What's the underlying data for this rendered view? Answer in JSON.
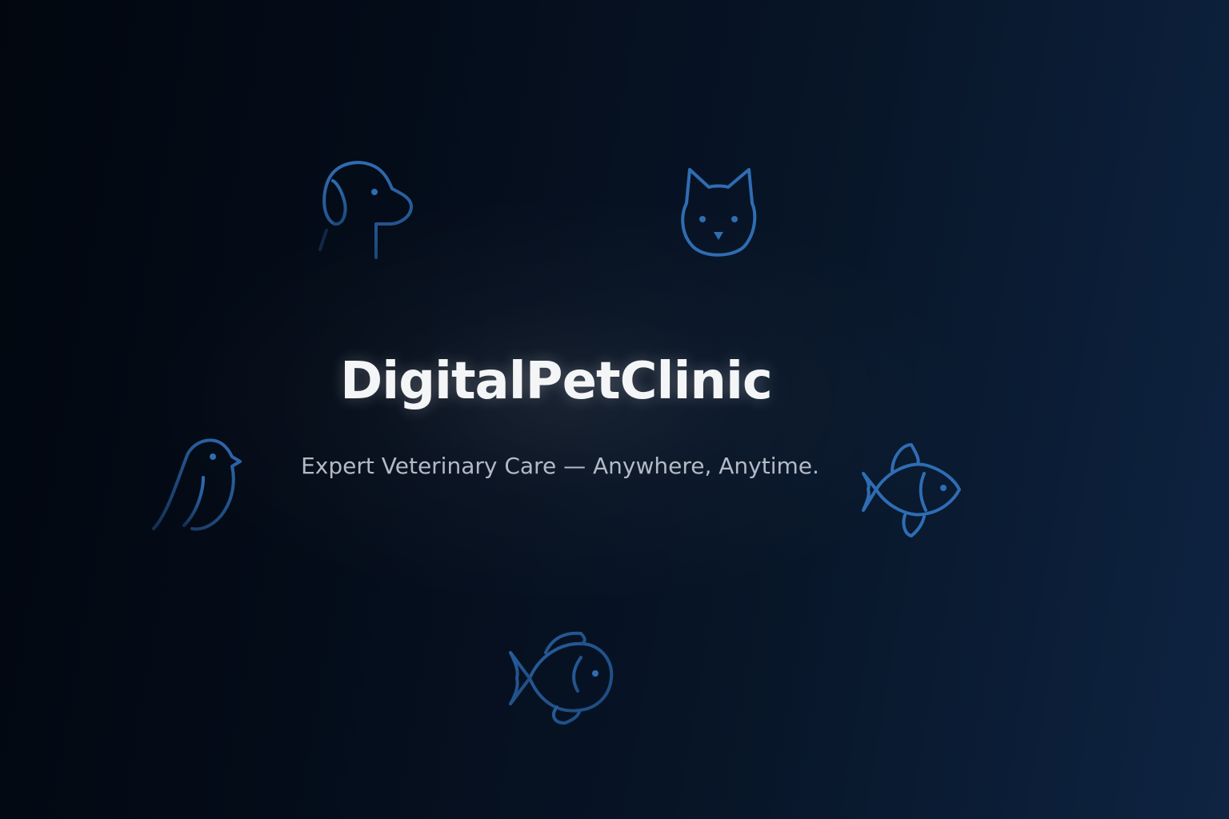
{
  "hero": {
    "title": "DigitalPetClinic",
    "tagline": "Expert Veterinary Care — Anywhere, Anytime."
  },
  "icons": [
    {
      "name": "dog-icon"
    },
    {
      "name": "cat-icon"
    },
    {
      "name": "bird-icon"
    },
    {
      "name": "fish-icon"
    },
    {
      "name": "fish-icon"
    }
  ],
  "colors": {
    "background_dark": "#02070f",
    "background_light": "#0e2442",
    "icon_stroke": "#2f6db3",
    "title": "#f4f5f7",
    "tagline": "#b3bac6"
  }
}
